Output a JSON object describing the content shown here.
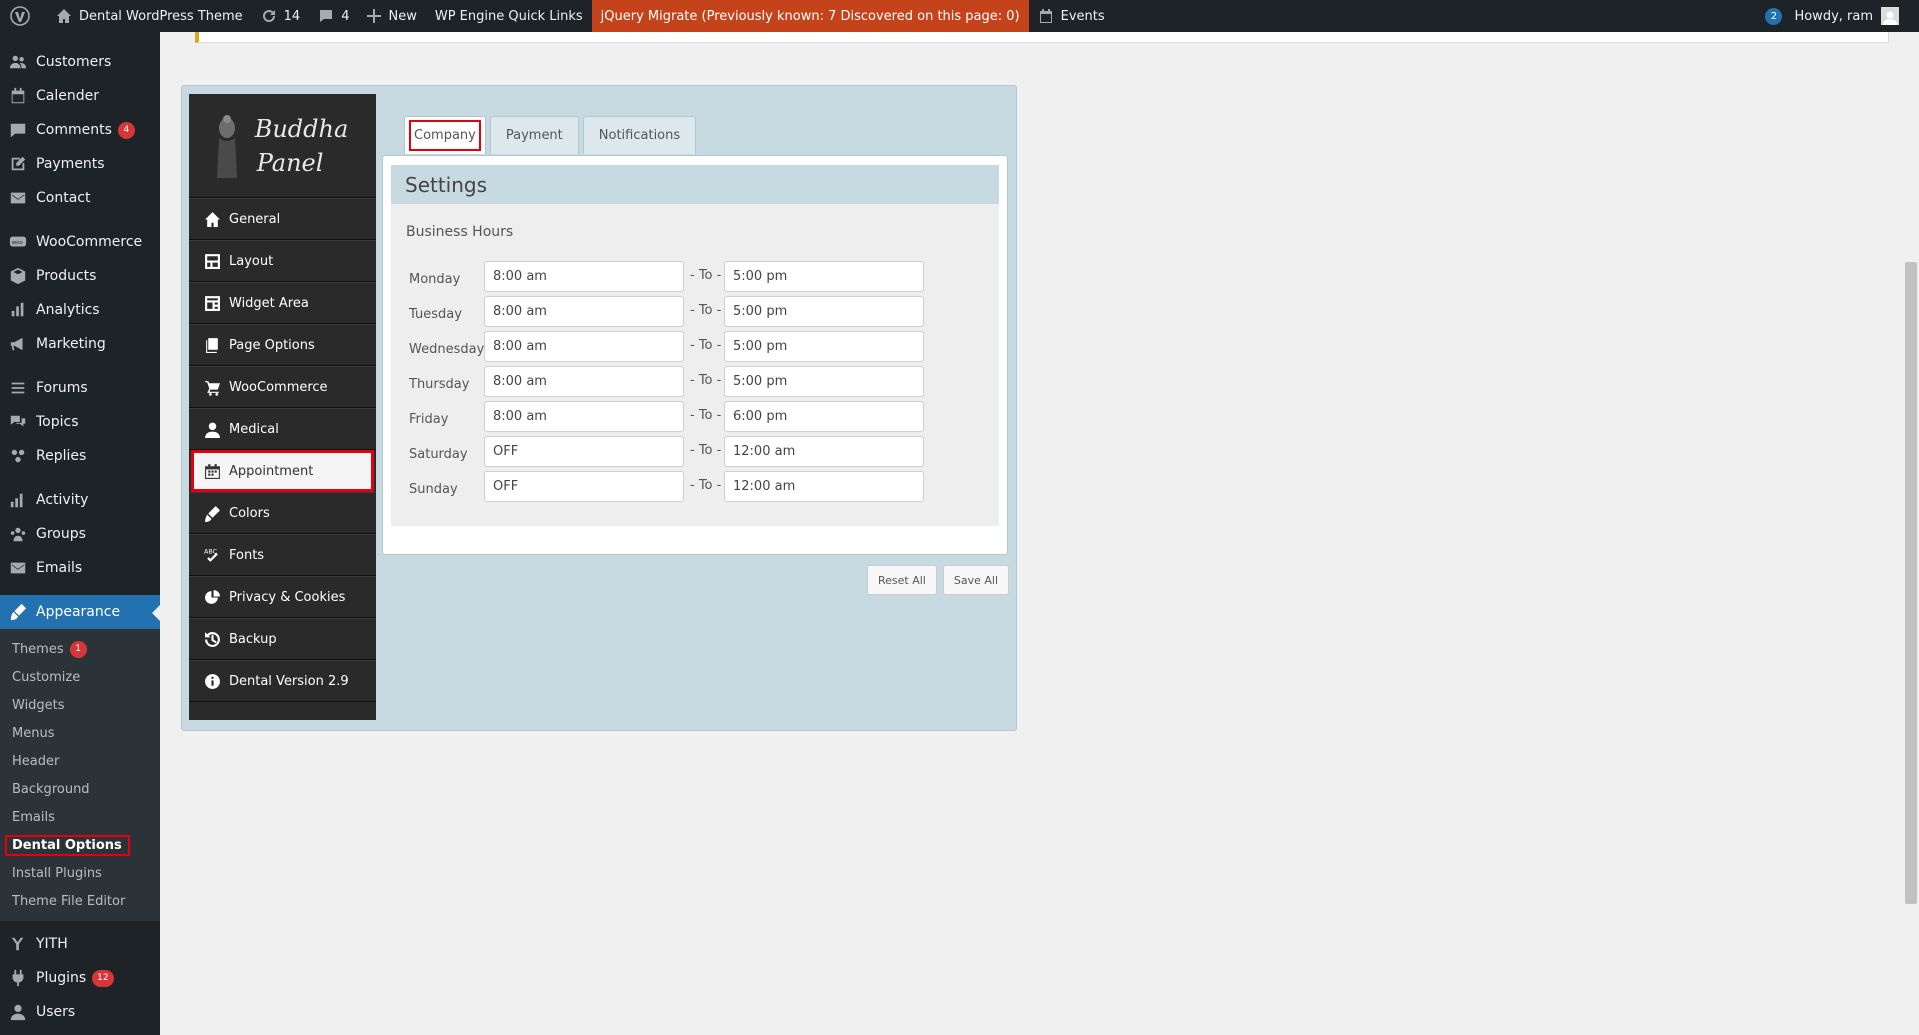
{
  "adminbar": {
    "site_name": "Dental WordPress Theme",
    "updates_count": "14",
    "comments_count": "4",
    "new_label": "New",
    "wpengine_label": "WP Engine Quick Links",
    "jquery_label": "jQuery Migrate (Previously known: 7 Discovered on this page: 0)",
    "events_label": "Events",
    "notification_count": "2",
    "howdy": "Howdy, ram"
  },
  "sidebar": {
    "items_top": [
      {
        "label": "Customers",
        "icon": "users-icon"
      },
      {
        "label": "Calender",
        "icon": "calendar-icon"
      },
      {
        "label": "Comments",
        "icon": "comment-icon",
        "badge": "4"
      },
      {
        "label": "Payments",
        "icon": "edit-icon"
      },
      {
        "label": "Contact",
        "icon": "mail-icon"
      }
    ],
    "items_woo": [
      {
        "label": "WooCommerce",
        "icon": "woo-icon"
      },
      {
        "label": "Products",
        "icon": "box-icon"
      },
      {
        "label": "Analytics",
        "icon": "bar-chart-icon"
      },
      {
        "label": "Marketing",
        "icon": "megaphone-icon"
      }
    ],
    "items_forum": [
      {
        "label": "Forums",
        "icon": "forums-icon"
      },
      {
        "label": "Topics",
        "icon": "topics-icon"
      },
      {
        "label": "Replies",
        "icon": "replies-icon"
      }
    ],
    "items_bp": [
      {
        "label": "Activity",
        "icon": "activity-icon"
      },
      {
        "label": "Groups",
        "icon": "groups-icon"
      },
      {
        "label": "Emails",
        "icon": "mail-icon"
      }
    ],
    "appearance": {
      "label": "Appearance",
      "icon": "brush-icon"
    },
    "submenu": {
      "themes": "Themes",
      "themes_badge": "1",
      "customize": "Customize",
      "widgets": "Widgets",
      "menus": "Menus",
      "header": "Header",
      "background": "Background",
      "emails": "Emails",
      "dental_options": "Dental Options",
      "install_plugins": "Install Plugins",
      "theme_file_editor": "Theme File Editor"
    },
    "items_bottom": [
      {
        "label": "YITH",
        "icon": "yith-icon"
      },
      {
        "label": "Plugins",
        "icon": "plug-icon",
        "badge": "12"
      },
      {
        "label": "Users",
        "icon": "user-icon"
      }
    ]
  },
  "panel": {
    "logo_line1": "Buddha",
    "logo_line2": "Panel",
    "nav": [
      {
        "label": "General",
        "icon": "home-icon"
      },
      {
        "label": "Layout",
        "icon": "layout-icon"
      },
      {
        "label": "Widget Area",
        "icon": "widget-icon"
      },
      {
        "label": "Page Options",
        "icon": "pages-icon"
      },
      {
        "label": "WooCommerce",
        "icon": "cart-icon"
      },
      {
        "label": "Medical",
        "icon": "person-icon"
      },
      {
        "label": "Appointment",
        "icon": "calendar-icon",
        "active": true
      },
      {
        "label": "Colors",
        "icon": "brush-icon"
      },
      {
        "label": "Fonts",
        "icon": "fonts-icon"
      },
      {
        "label": "Privacy & Cookies",
        "icon": "pie-icon"
      },
      {
        "label": "Backup",
        "icon": "history-icon"
      },
      {
        "label": "Dental Version 2.9",
        "icon": "info-icon"
      }
    ],
    "tabs": [
      "Company",
      "Payment",
      "Notifications"
    ],
    "settings_title": "Settings",
    "business_hours_title": "Business Hours",
    "to_label": "- To -",
    "hours": [
      {
        "day": "Monday",
        "from": "8:00 am",
        "to": "5:00 pm"
      },
      {
        "day": "Tuesday",
        "from": "8:00 am",
        "to": "5:00 pm"
      },
      {
        "day": "Wednesday",
        "from": "8:00 am",
        "to": "5:00 pm"
      },
      {
        "day": "Thursday",
        "from": "8:00 am",
        "to": "5:00 pm"
      },
      {
        "day": "Friday",
        "from": "8:00 am",
        "to": "6:00 pm"
      },
      {
        "day": "Saturday",
        "from": "OFF",
        "to": "12:00 am"
      },
      {
        "day": "Sunday",
        "from": "OFF",
        "to": "12:00 am"
      }
    ],
    "reset_label": "Reset All",
    "save_label": "Save All"
  }
}
